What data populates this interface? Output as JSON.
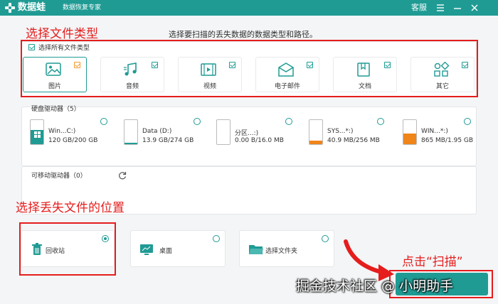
{
  "app": {
    "name": "数据蛙",
    "subtitle": "数据恢复专家",
    "service_label": "客服"
  },
  "colors": {
    "accent": "#1f9b94",
    "checkbox_selected": "#f29b32",
    "annotation": "#e51d1d",
    "drive_fill_normal": "#1f9b94",
    "drive_fill_warning": "#f08519"
  },
  "header_text": "选择要扫描的丢失数据的数据类型和路径。",
  "file_types": {
    "select_all_label": "选择所有文件类型",
    "items": [
      {
        "label": "图片",
        "icon": "image-icon",
        "selected": true
      },
      {
        "label": "音频",
        "icon": "music-icon",
        "selected": false
      },
      {
        "label": "视频",
        "icon": "video-icon",
        "selected": false
      },
      {
        "label": "电子邮件",
        "icon": "email-icon",
        "selected": false
      },
      {
        "label": "文档",
        "icon": "document-icon",
        "selected": false
      },
      {
        "label": "其它",
        "icon": "other-icon",
        "selected": false
      }
    ]
  },
  "disks": {
    "title": "硬盘驱动器（5）",
    "items": [
      {
        "name": "Win...C:)",
        "size": "120 GB/200 GB",
        "used": 0.6,
        "color": "#1f9b94",
        "windows_logo": true
      },
      {
        "name": "Data (D:)",
        "size": "13.9 GB/274 GB",
        "used": 0.05,
        "color": "#1f9b94",
        "windows_logo": false
      },
      {
        "name": "分区...:)",
        "size": "0.00  B/16.0 MB",
        "used": 0.0,
        "color": "#1f9b94",
        "windows_logo": false
      },
      {
        "name": "SYS...*:)",
        "size": "40.9 MB/256 MB",
        "used": 0.16,
        "color": "#f08519",
        "windows_logo": false
      },
      {
        "name": "WIN...*:)",
        "size": "865 MB/1.95 GB",
        "used": 0.44,
        "color": "#f08519",
        "windows_logo": false
      }
    ]
  },
  "removable": {
    "title": "可移动驱动器（0）"
  },
  "locations": [
    {
      "label": "回收站",
      "icon": "recycle-bin-icon",
      "selected": true
    },
    {
      "label": "桌面",
      "icon": "desktop-icon",
      "selected": false
    },
    {
      "label": "选择文件夹",
      "icon": "folder-icon",
      "selected": false
    }
  ],
  "annotations": {
    "file_type": "选择文件类型",
    "location": "选择丢失文件的位置",
    "scan": "点击“扫描”"
  },
  "watermark": "掘金技术社区 @ 小明助手"
}
